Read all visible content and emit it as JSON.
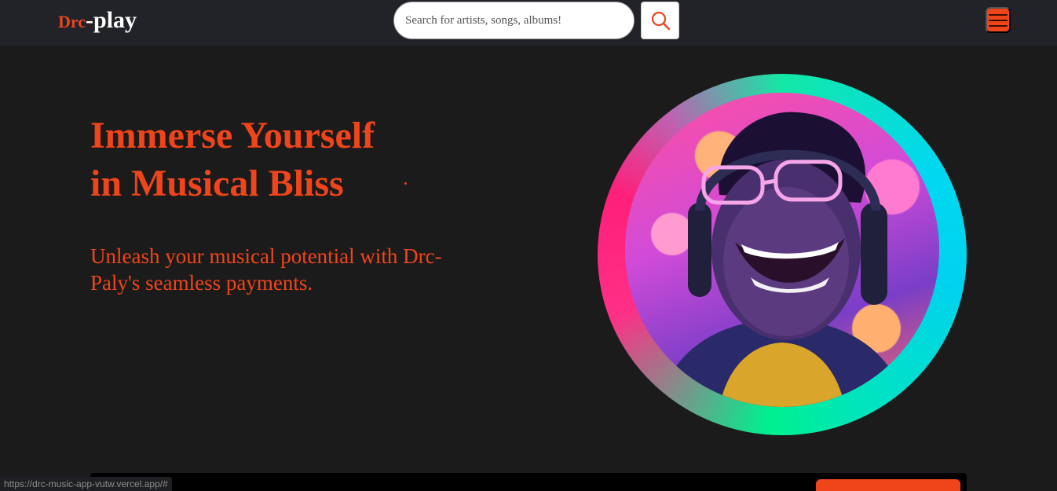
{
  "navbar": {
    "logo_accent": "Drc",
    "logo_main": "-play",
    "search_placeholder": "Search for artists, songs, albums!",
    "search_icon": "search-icon",
    "menu_icon": "hamburger-menu-icon"
  },
  "hero": {
    "title_line1": "Immerse Yourself",
    "title_line2": "in Musical Bliss",
    "subtitle": "Unleash your musical potential with Drc-Paly's seamless payments."
  },
  "status_bar": {
    "url": "https://drc-music-app-vutw.vercel.app/#"
  },
  "colors": {
    "accent": "#f0451b",
    "background": "#1b1b1c",
    "navbar": "#212328"
  }
}
